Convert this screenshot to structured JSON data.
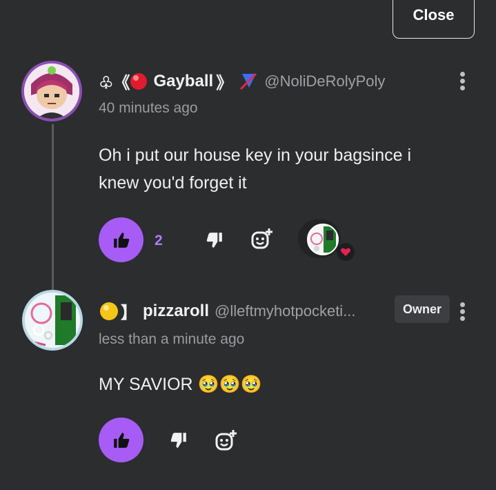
{
  "header": {
    "close_label": "Close"
  },
  "comments": [
    {
      "name_prefix": "♧《",
      "name": "Gayball",
      "name_suffix": "》",
      "handle": "@NoliDeRolyPoly",
      "time": "40 minutes ago",
      "message_line1": "Oh i put our house key in your bagsince i",
      "message_line2": "knew you'd forget it",
      "like_count": "2",
      "reaction_icon": "heart-icon"
    },
    {
      "name": "pizzaroll",
      "handle": "@lleftmyhotpocketi...",
      "badge": "Owner",
      "time": "less than a minute ago",
      "message": "MY SAVIOR 🥹🥹🥹"
    }
  ],
  "colors": {
    "background": "#2b2d2f",
    "accent": "#a65cf5",
    "count": "#b27cf7",
    "muted": "#9a9c9f",
    "heart": "#e8224f"
  }
}
